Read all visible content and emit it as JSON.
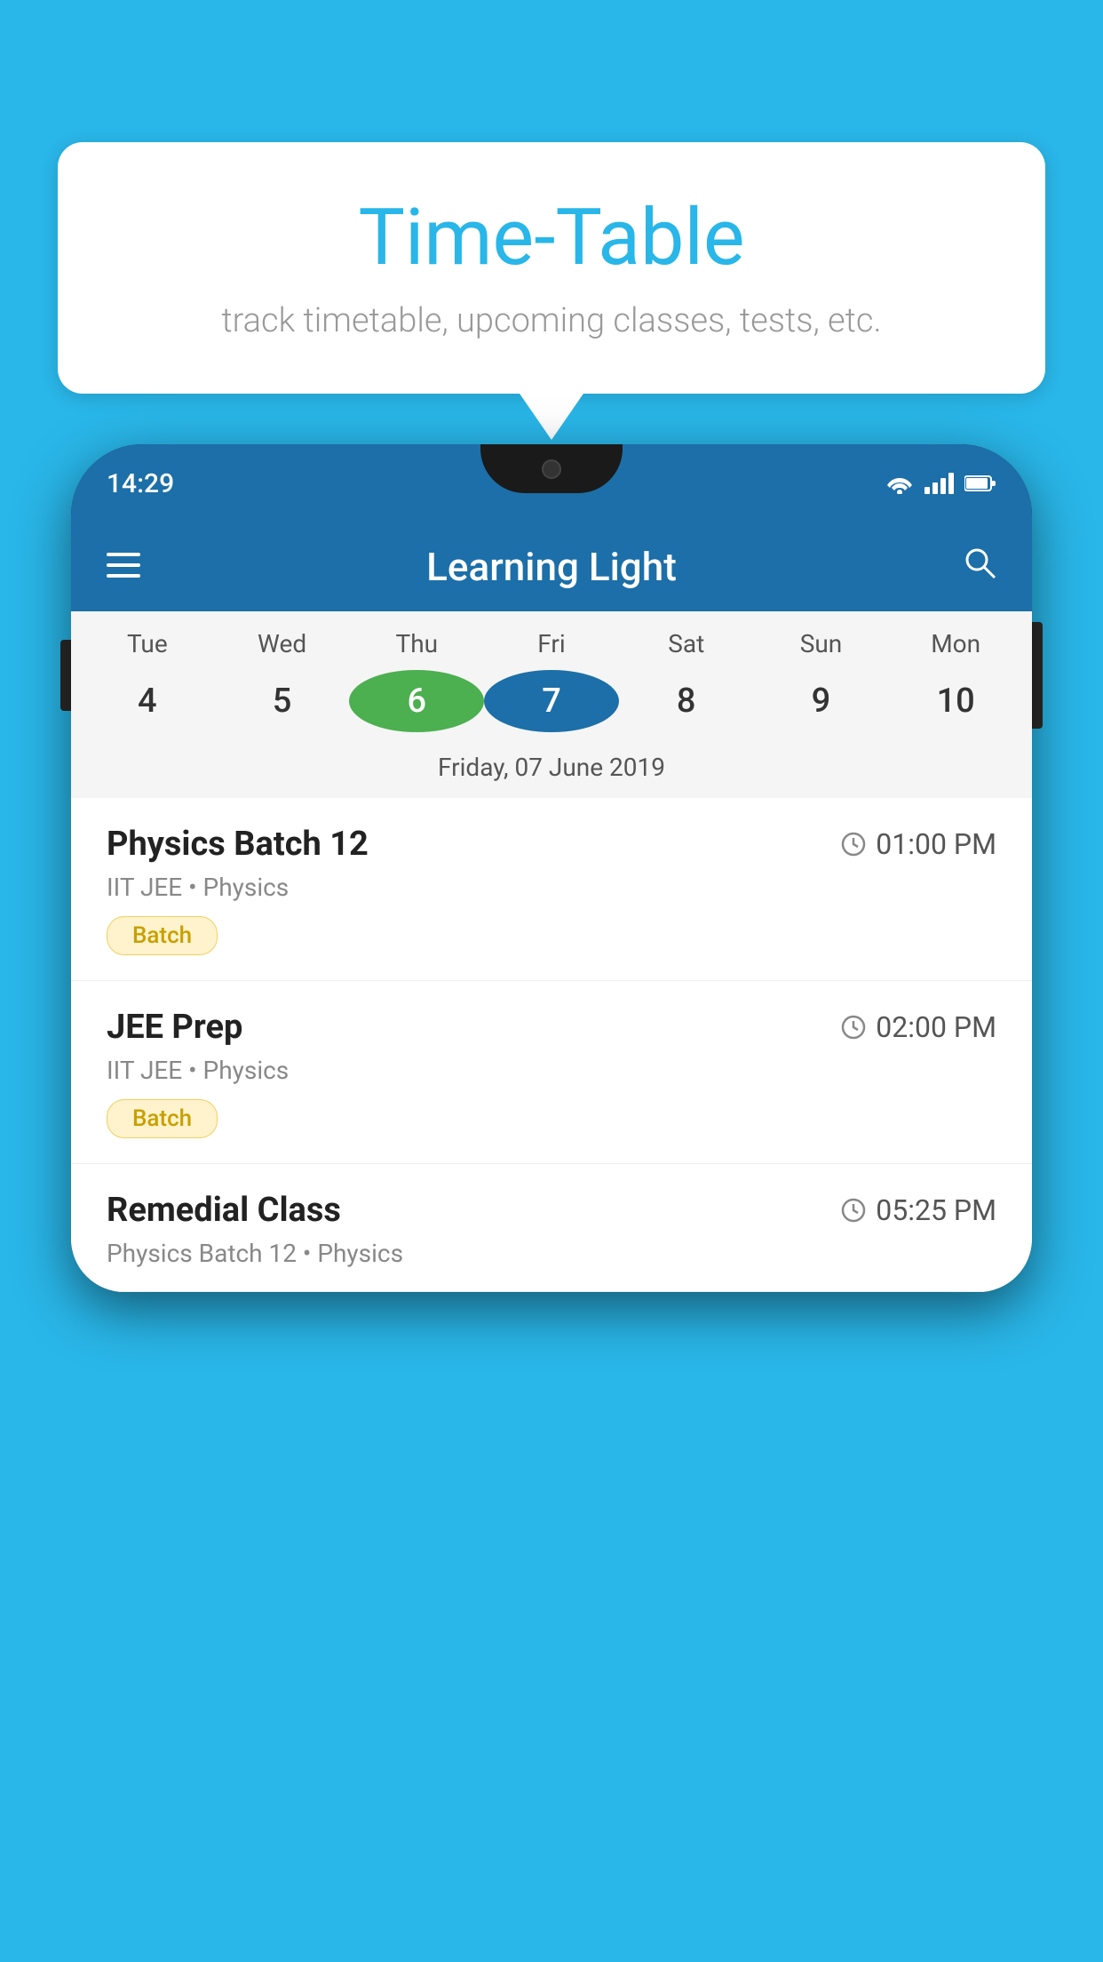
{
  "background_color": "#29b6e8",
  "speech_bubble": {
    "title": "Time-Table",
    "subtitle": "track timetable, upcoming classes, tests, etc."
  },
  "app": {
    "title": "Learning Light",
    "status_time": "14:29"
  },
  "calendar": {
    "days": [
      "Tue",
      "Wed",
      "Thu",
      "Fri",
      "Sat",
      "Sun",
      "Mon"
    ],
    "dates": [
      "4",
      "5",
      "6",
      "7",
      "8",
      "9",
      "10"
    ],
    "today_index": 2,
    "selected_index": 3,
    "selected_label": "Friday, 07 June 2019"
  },
  "schedule": [
    {
      "title": "Physics Batch 12",
      "time": "01:00 PM",
      "subtitle": "IIT JEE • Physics",
      "badge": "Batch"
    },
    {
      "title": "JEE Prep",
      "time": "02:00 PM",
      "subtitle": "IIT JEE • Physics",
      "badge": "Batch"
    },
    {
      "title": "Remedial Class",
      "time": "05:25 PM",
      "subtitle": "Physics Batch 12 • Physics",
      "badge": null
    }
  ]
}
